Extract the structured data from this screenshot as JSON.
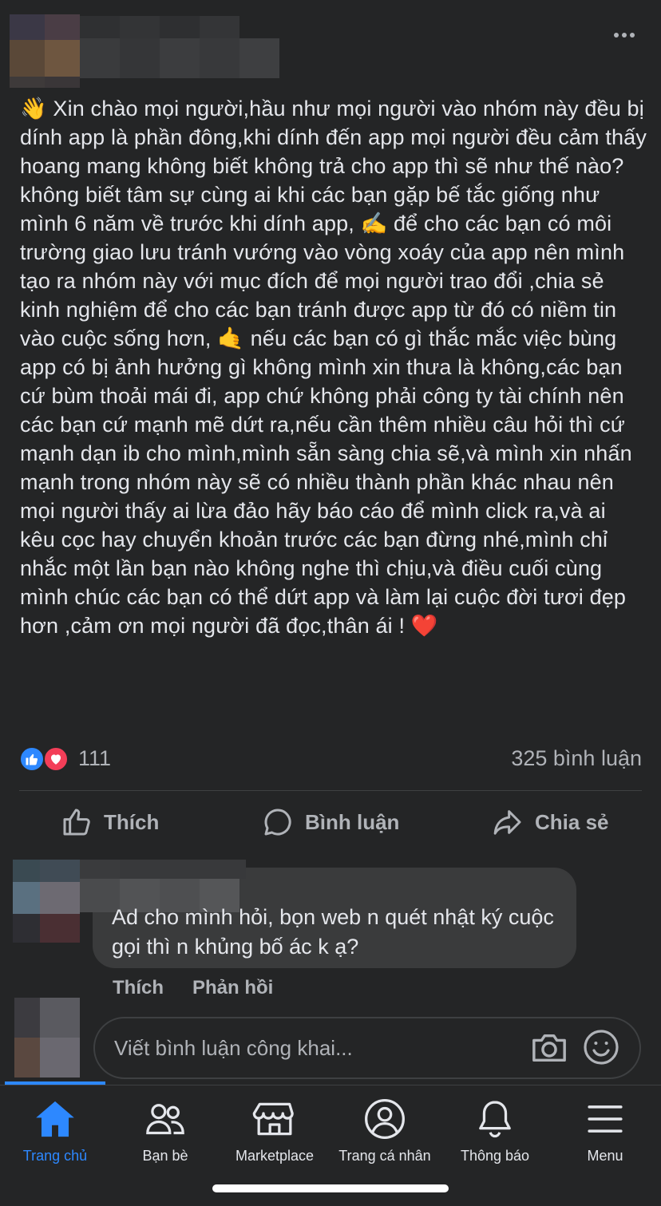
{
  "post": {
    "body": "👋  Xin chào mọi người,hầu như mọi người vào nhóm này đều bị dính app là phần đông,khi dính đến app mọi người đều cảm thấy hoang mang không biết không trả cho app thì sẽ như thế nào?không biết tâm sự cùng ai khi các bạn gặp bế tắc giống như mình 6 năm về trước khi dính app, ✍️ để cho các bạn có môi trường giao lưu tránh vướng vào vòng xoáy của app nên mình tạo ra nhóm này với mục đích để mọi người trao đổi ,chia sẻ kinh nghiệm để cho các bạn tránh được app từ đó có niềm tin vào cuộc sống hơn, 🤙 nếu các bạn có gì thắc mắc việc bùng app có bị ảnh hưởng gì không mình xin thưa là không,các bạn cứ bùm thoải mái đi, app chứ không phải công ty tài chính nên các bạn cứ mạnh mẽ dứt ra,nếu cần thêm nhiều câu hỏi thì cứ mạnh dạn ib cho mình,mình sẵn sàng chia sẽ,và mình xin nhấn mạnh trong nhóm này sẽ có nhiều thành phần khác nhau nên mọi người thấy ai lừa đảo hãy báo cáo để mình click ra,và ai kêu cọc hay chuyển khoản trước các bạn đừng nhé,mình chỉ nhắc một lần bạn nào không nghe thì chịu,và điều cuối cùng mình chúc các bạn có thể dứt app và làm lại cuộc đời tươi đẹp hơn ,cảm ơn mọi người đã đọc,thân ái ! ❤️",
    "reaction_count": "111",
    "comment_count": "325 bình luận"
  },
  "actions": {
    "like": "Thích",
    "comment": "Bình luận",
    "share": "Chia sẻ"
  },
  "comment": {
    "text": "Ad cho mình hỏi, bọn web n quét nhật ký cuộc gọi thì n khủng bố ác k ạ?",
    "like": "Thích",
    "reply": "Phản hồi"
  },
  "composer": {
    "placeholder": "Viết bình luận công khai..."
  },
  "tabs": [
    {
      "label": "Trang chủ",
      "icon": "home-icon",
      "active": true
    },
    {
      "label": "Bạn bè",
      "icon": "friends-icon",
      "active": false
    },
    {
      "label": "Marketplace",
      "icon": "marketplace-icon",
      "active": false
    },
    {
      "label": "Trang cá nhân",
      "icon": "profile-icon",
      "active": false
    },
    {
      "label": "Thông báo",
      "icon": "bell-icon",
      "active": false
    },
    {
      "label": "Menu",
      "icon": "menu-icon",
      "active": false
    }
  ],
  "colors": {
    "background": "#242526",
    "accent": "#2d88ff",
    "love": "#f33e58",
    "text_secondary": "#b0b3b8"
  }
}
